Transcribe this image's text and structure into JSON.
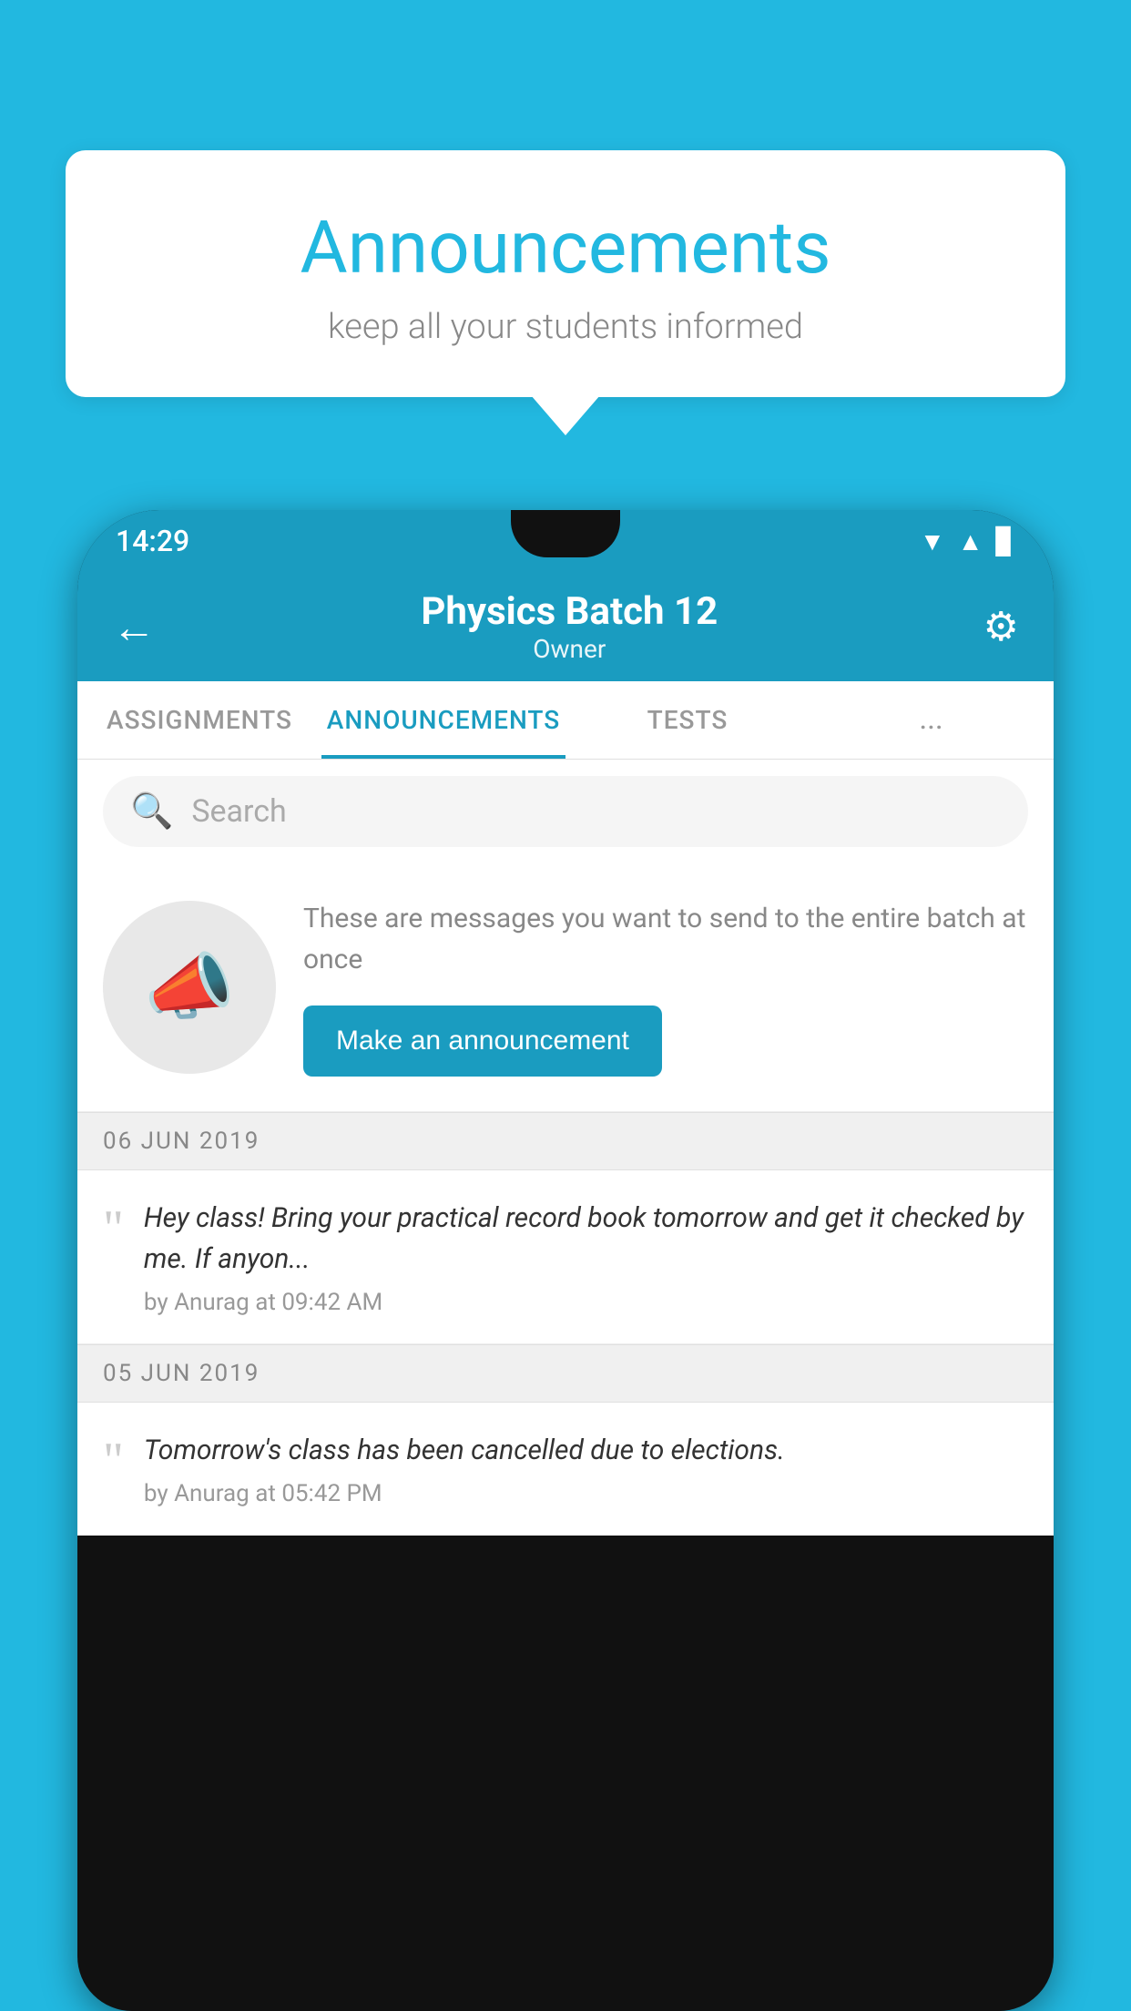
{
  "background_color": "#22b8e0",
  "speech_bubble": {
    "title": "Announcements",
    "subtitle": "keep all your students informed"
  },
  "phone": {
    "status_bar": {
      "time": "14:29",
      "icons": [
        "wifi",
        "signal",
        "battery"
      ]
    },
    "header": {
      "title": "Physics Batch 12",
      "subtitle": "Owner",
      "back_label": "←",
      "settings_label": "⚙"
    },
    "tabs": [
      {
        "label": "ASSIGNMENTS",
        "active": false
      },
      {
        "label": "ANNOUNCEMENTS",
        "active": true
      },
      {
        "label": "TESTS",
        "active": false
      },
      {
        "label": "...",
        "active": false
      }
    ],
    "search": {
      "placeholder": "Search"
    },
    "promo": {
      "description_text": "These are messages you want to send to the entire batch at once",
      "button_label": "Make an announcement"
    },
    "announcements": [
      {
        "date": "06  JUN  2019",
        "text": "Hey class! Bring your practical record book tomorrow and get it checked by me. If anyon...",
        "meta": "by Anurag at 09:42 AM"
      },
      {
        "date": "05  JUN  2019",
        "text": "Tomorrow's class has been cancelled due to elections.",
        "meta": "by Anurag at 05:42 PM"
      }
    ]
  }
}
